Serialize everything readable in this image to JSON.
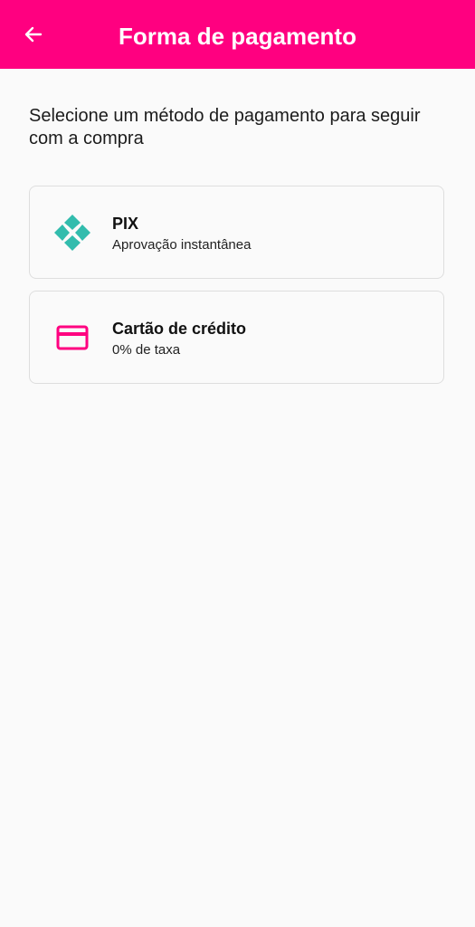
{
  "header": {
    "title": "Forma de pagamento",
    "back_icon": "arrow-left-icon",
    "background_color": "#ff0080",
    "text_color": "#ffffff"
  },
  "main": {
    "intro_text": "Selecione um método de pagamento para seguir com a compra",
    "payment_options": [
      {
        "title": "PIX",
        "subtitle": "Aprovação instantânea",
        "icon": "pix-icon",
        "icon_color": "#32bcad"
      },
      {
        "title": "Cartão de crédito",
        "subtitle": "0% de taxa",
        "icon": "credit-card-icon",
        "icon_color": "#ff0080"
      }
    ]
  }
}
